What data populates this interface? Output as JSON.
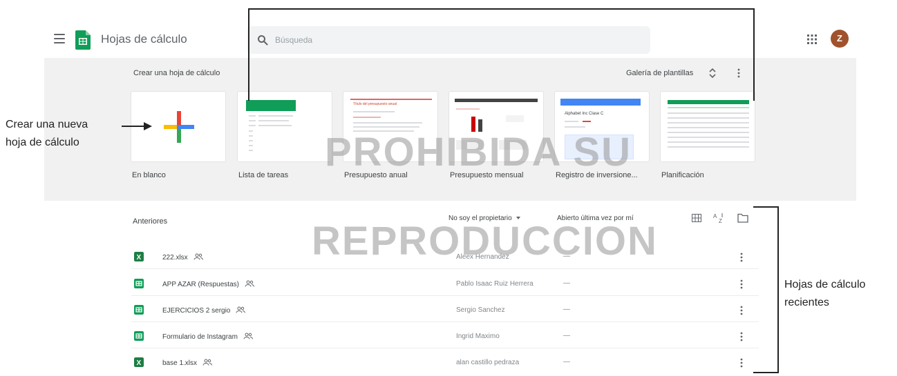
{
  "header": {
    "app_title": "Hojas de cálculo",
    "search_placeholder": "Búsqueda",
    "avatar_initial": "Z",
    "icons": [
      "menu-icon",
      "sheets-logo-icon",
      "search-icon",
      "apps-grid-icon"
    ],
    "colors": {
      "sheets_green": "#0f9d58",
      "avatar": "#a0522d"
    }
  },
  "templates": {
    "title": "Crear una hoja de cálculo",
    "gallery_label": "Galería de plantillas",
    "items": [
      {
        "label": "En blanco"
      },
      {
        "label": "Lista de tareas"
      },
      {
        "label": "Presupuesto anual"
      },
      {
        "label": "Presupuesto mensual"
      },
      {
        "label": "Registro de inversione..."
      },
      {
        "label": "Planificación"
      }
    ],
    "thumbnails": {
      "annual_budget_heading": "Título del presupuesto anual",
      "investment_heading": "Alphabet Inc Clase C"
    },
    "colors": {
      "blank_plus": [
        "#4285f4",
        "#ea4335",
        "#fbbc04",
        "#34a853"
      ]
    }
  },
  "recent": {
    "title": "Anteriores",
    "owner_filter": "No soy el propietario",
    "sort_label": "Abierto última vez por mí",
    "files": [
      {
        "name": "222.xlsx",
        "type": "excel",
        "owner": "Aleex Hernandez",
        "last_opened": "—"
      },
      {
        "name": "APP AZAR (Respuestas)",
        "type": "sheets",
        "owner": "Pablo Isaac Ruiz Herrera",
        "last_opened": "—"
      },
      {
        "name": "EJERCICIOS 2 sergio",
        "type": "sheets",
        "owner": "Sergio Sanchez",
        "last_opened": "—"
      },
      {
        "name": "Formulario de Instagram",
        "type": "sheets",
        "owner": "Ingrid Maximo",
        "last_opened": "—"
      },
      {
        "name": "base 1.xlsx",
        "type": "excel",
        "owner": "alan castillo pedraza",
        "last_opened": "—"
      }
    ],
    "colors": {
      "excel": "#1e7e45",
      "sheets": "#0f9d58"
    }
  },
  "annotations": {
    "new_sheet_line1": "Crear una nueva",
    "new_sheet_line2": "hoja de cálculo",
    "recent_line1": "Hojas de cálculo",
    "recent_line2": "recientes"
  },
  "watermark": {
    "line1": "PROHIBIDA SU",
    "line2": "REPRODUCCION"
  }
}
